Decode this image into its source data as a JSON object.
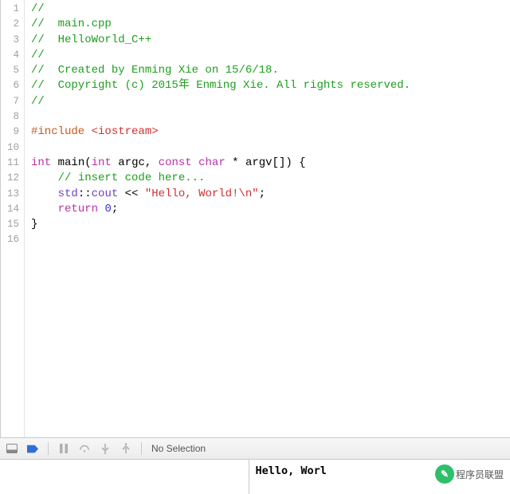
{
  "gutter": {
    "lines": [
      "1",
      "2",
      "3",
      "4",
      "5",
      "6",
      "7",
      "8",
      "9",
      "10",
      "11",
      "12",
      "13",
      "14",
      "15",
      "16"
    ]
  },
  "code": {
    "lines": [
      [
        {
          "t": "comment",
          "v": "//"
        }
      ],
      [
        {
          "t": "comment",
          "v": "//  main.cpp"
        }
      ],
      [
        {
          "t": "comment",
          "v": "//  HelloWorld_C++"
        }
      ],
      [
        {
          "t": "comment",
          "v": "//"
        }
      ],
      [
        {
          "t": "comment",
          "v": "//  Created by Enming Xie on 15/6/18."
        }
      ],
      [
        {
          "t": "comment",
          "v": "//  Copyright (c) 2015年 Enming Xie. All rights reserved."
        }
      ],
      [
        {
          "t": "comment",
          "v": "//"
        }
      ],
      [],
      [
        {
          "t": "preproc",
          "v": "#include "
        },
        {
          "t": "preproc-target",
          "v": "<iostream>"
        }
      ],
      [],
      [
        {
          "t": "keyword",
          "v": "int"
        },
        {
          "t": "plain",
          "v": " "
        },
        {
          "t": "ident",
          "v": "main"
        },
        {
          "t": "plain",
          "v": "("
        },
        {
          "t": "keyword",
          "v": "int"
        },
        {
          "t": "plain",
          "v": " "
        },
        {
          "t": "ident",
          "v": "argc"
        },
        {
          "t": "plain",
          "v": ", "
        },
        {
          "t": "keyword",
          "v": "const"
        },
        {
          "t": "plain",
          "v": " "
        },
        {
          "t": "keyword",
          "v": "char"
        },
        {
          "t": "plain",
          "v": " * "
        },
        {
          "t": "ident",
          "v": "argv"
        },
        {
          "t": "plain",
          "v": "[]) {"
        }
      ],
      [
        {
          "t": "plain",
          "v": "    "
        },
        {
          "t": "comment",
          "v": "// insert code here..."
        }
      ],
      [
        {
          "t": "plain",
          "v": "    "
        },
        {
          "t": "scope",
          "v": "std"
        },
        {
          "t": "plain",
          "v": "::"
        },
        {
          "t": "scope",
          "v": "cout"
        },
        {
          "t": "plain",
          "v": " << "
        },
        {
          "t": "string",
          "v": "\"Hello, World!\\n\""
        },
        {
          "t": "plain",
          "v": ";"
        }
      ],
      [
        {
          "t": "plain",
          "v": "    "
        },
        {
          "t": "keyword",
          "v": "return"
        },
        {
          "t": "plain",
          "v": " "
        },
        {
          "t": "number",
          "v": "0"
        },
        {
          "t": "plain",
          "v": ";"
        }
      ],
      [
        {
          "t": "plain",
          "v": "}"
        }
      ],
      []
    ]
  },
  "debug_bar": {
    "no_selection": "No Selection"
  },
  "console": {
    "output": "Hello, Worl"
  },
  "watermark": {
    "label": "程序员联盟"
  }
}
